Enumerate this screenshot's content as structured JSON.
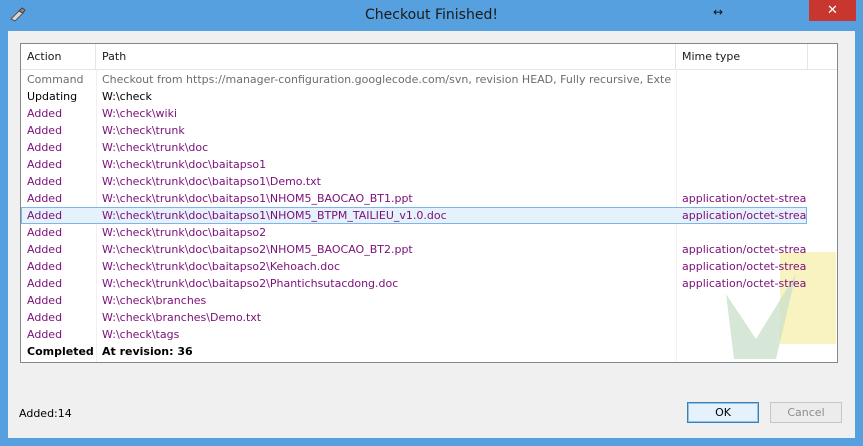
{
  "window": {
    "title": "Checkout Finished!",
    "close_label": "✕",
    "resize_label": "↔"
  },
  "list": {
    "columns": [
      "Action",
      "Path",
      "Mime type",
      ""
    ],
    "rows": [
      {
        "action": "Command",
        "path": "Checkout from https://manager-configuration.googlecode.com/svn, revision HEAD, Fully recursive, Externals included",
        "mime": "",
        "kind": "command"
      },
      {
        "action": "Updating",
        "path": "W:\\check",
        "mime": "",
        "kind": "update"
      },
      {
        "action": "Added",
        "path": "W:\\check\\wiki",
        "mime": "",
        "kind": "added"
      },
      {
        "action": "Added",
        "path": "W:\\check\\trunk",
        "mime": "",
        "kind": "added"
      },
      {
        "action": "Added",
        "path": "W:\\check\\trunk\\doc",
        "mime": "",
        "kind": "added"
      },
      {
        "action": "Added",
        "path": "W:\\check\\trunk\\doc\\baitapso1",
        "mime": "",
        "kind": "added"
      },
      {
        "action": "Added",
        "path": "W:\\check\\trunk\\doc\\baitapso1\\Demo.txt",
        "mime": "",
        "kind": "added"
      },
      {
        "action": "Added",
        "path": "W:\\check\\trunk\\doc\\baitapso1\\NHOM5_BAOCAO_BT1.ppt",
        "mime": "application/octet-stream",
        "kind": "added"
      },
      {
        "action": "Added",
        "path": "W:\\check\\trunk\\doc\\baitapso1\\NHOM5_BTPM_TAILIEU_v1.0.doc",
        "mime": "application/octet-stream",
        "kind": "added",
        "selected": true
      },
      {
        "action": "Added",
        "path": "W:\\check\\trunk\\doc\\baitapso2",
        "mime": "",
        "kind": "added"
      },
      {
        "action": "Added",
        "path": "W:\\check\\trunk\\doc\\baitapso2\\NHOM5_BAOCAO_BT2.ppt",
        "mime": "application/octet-stream",
        "kind": "added"
      },
      {
        "action": "Added",
        "path": "W:\\check\\trunk\\doc\\baitapso2\\Kehoach.doc",
        "mime": "application/octet-stream",
        "kind": "added"
      },
      {
        "action": "Added",
        "path": "W:\\check\\trunk\\doc\\baitapso2\\Phantichsutacdong.doc",
        "mime": "application/octet-stream",
        "kind": "added"
      },
      {
        "action": "Added",
        "path": "W:\\check\\branches",
        "mime": "",
        "kind": "added"
      },
      {
        "action": "Added",
        "path": "W:\\check\\branches\\Demo.txt",
        "mime": "",
        "kind": "added"
      },
      {
        "action": "Added",
        "path": "W:\\check\\tags",
        "mime": "",
        "kind": "added"
      },
      {
        "action": "Completed",
        "path": "At revision: 36",
        "mime": "",
        "kind": "completed"
      }
    ]
  },
  "status": {
    "text": "Added:14"
  },
  "buttons": {
    "ok": "OK",
    "cancel": "Cancel"
  },
  "colors": {
    "frame": "#56a0e0",
    "added": "#7b0f79",
    "command": "#6d6d6d",
    "close": "#c7372f",
    "selection": "#e5f1fb"
  },
  "icons": [
    "app-icon",
    "resize-icon",
    "close-icon",
    "watermark-logo"
  ]
}
